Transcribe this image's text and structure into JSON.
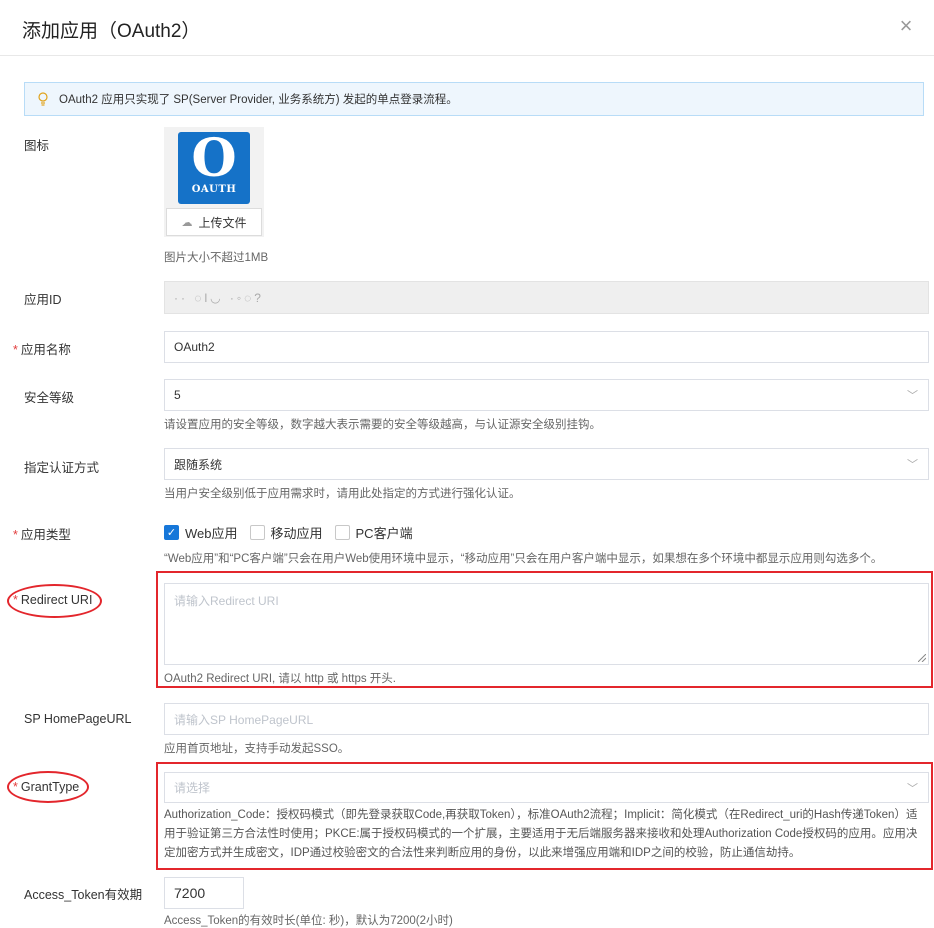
{
  "dialog": {
    "title": "添加应用（OAuth2）",
    "close_icon": "×"
  },
  "notice": {
    "text": "OAuth2 应用只实现了 SP(Server Provider, 业务系统方) 发起的单点登录流程。",
    "icon": "lightbulb-icon"
  },
  "icon_field": {
    "label": "图标",
    "logo_letter": "O",
    "logo_text": "OAUTH",
    "upload_label": "上传文件",
    "upload_icon": "cloud-upload-icon",
    "hint": "图片大小不超过1MB"
  },
  "app_id": {
    "label": "应用ID",
    "value": "·· ◌l◡ ·◦◌?"
  },
  "app_name": {
    "required": "*",
    "label": "应用名称",
    "value": "OAuth2"
  },
  "security_level": {
    "label": "安全等级",
    "value": "5",
    "hint": "请设置应用的安全等级，数字越大表示需要的安全等级越高，与认证源安全级别挂钩。"
  },
  "auth_method": {
    "label": "指定认证方式",
    "value": "跟随系统",
    "hint": "当用户安全级别低于应用需求时，请用此处指定的方式进行强化认证。"
  },
  "app_type": {
    "required": "*",
    "label": "应用类型",
    "options": [
      {
        "label": "Web应用",
        "checked": true
      },
      {
        "label": "移动应用",
        "checked": false
      },
      {
        "label": "PC客户端",
        "checked": false
      }
    ],
    "hint": "“Web应用”和“PC客户端”只会在用户Web使用环境中显示，“移动应用”只会在用户客户端中显示，如果想在多个环境中都显示应用则勾选多个。"
  },
  "redirect_uri": {
    "required": "*",
    "label": "Redirect URI",
    "placeholder": "请输入Redirect URI",
    "hint": "OAuth2 Redirect URI, 请以 http 或 https 开头."
  },
  "homepage": {
    "label": "SP HomePageURL",
    "placeholder": "请输入SP HomePageURL",
    "hint": "应用首页地址，支持手动发起SSO。"
  },
  "grant_type": {
    "required": "*",
    "label": "GrantType",
    "placeholder": "请选择",
    "desc": "Authorization_Code：授权码模式（即先登录获取Code,再获取Token），标准OAuth2流程；Implicit：简化模式（在Redirect_uri的Hash传递Token）适用于验证第三方合法性时使用；PKCE:属于授权码模式的一个扩展，主要适用于无后端服务器来接收和处理Authorization Code授权码的应用。应用决定加密方式并生成密文，IDP通过校验密文的合法性来判断应用的身份，以此来增强应用端和IDP之间的校验，防止通信劫持。"
  },
  "access_token": {
    "label": "Access_Token有效期",
    "value": "7200",
    "hint": "Access_Token的有效时长(单位: 秒)，默认为7200(2小时)"
  },
  "colors": {
    "accent": "#1677d9",
    "annotation_red": "#e3262c",
    "notice_bg": "#eef6fd"
  }
}
